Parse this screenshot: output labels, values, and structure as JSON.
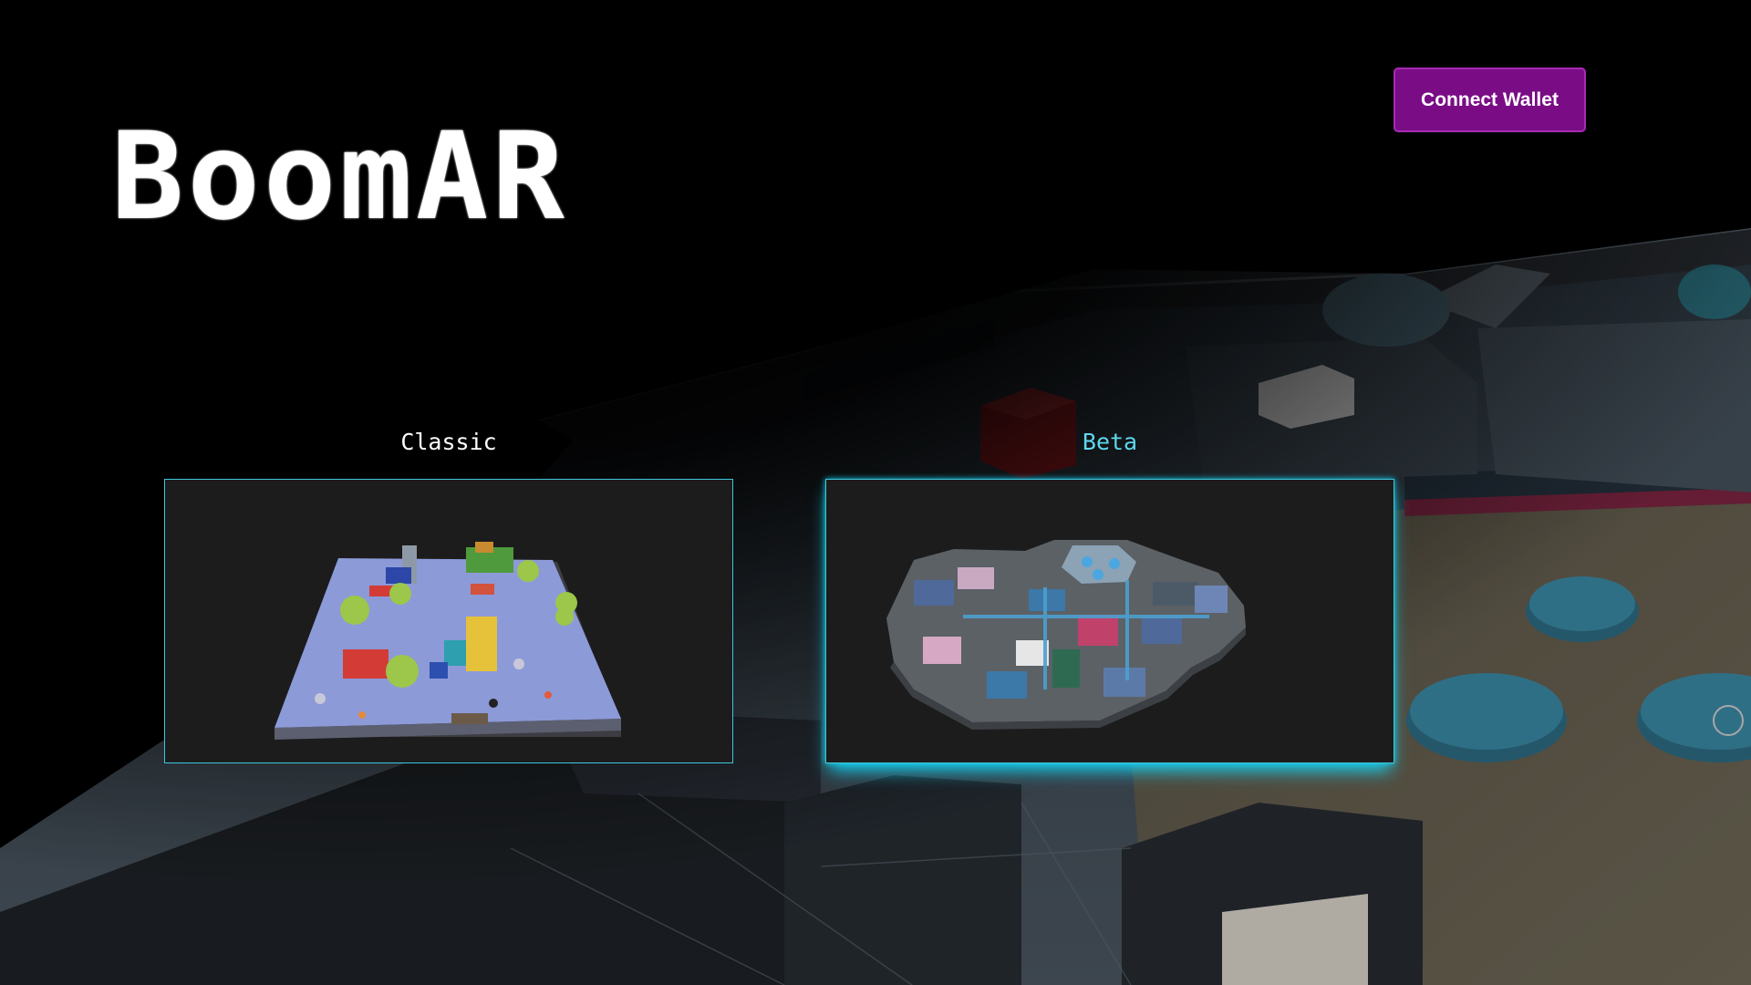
{
  "app": {
    "title": "BoomAR"
  },
  "header": {
    "connect_wallet_label": "Connect Wallet"
  },
  "maps": [
    {
      "label": "Classic",
      "selected": false,
      "preview_icon": "classic-map-preview"
    },
    {
      "label": "Beta",
      "selected": true,
      "preview_icon": "beta-map-preview"
    }
  ],
  "colors": {
    "accent_purple": "#7a0d86",
    "accent_cyan": "#16d0f0",
    "selected_label": "#5fd8f0"
  }
}
